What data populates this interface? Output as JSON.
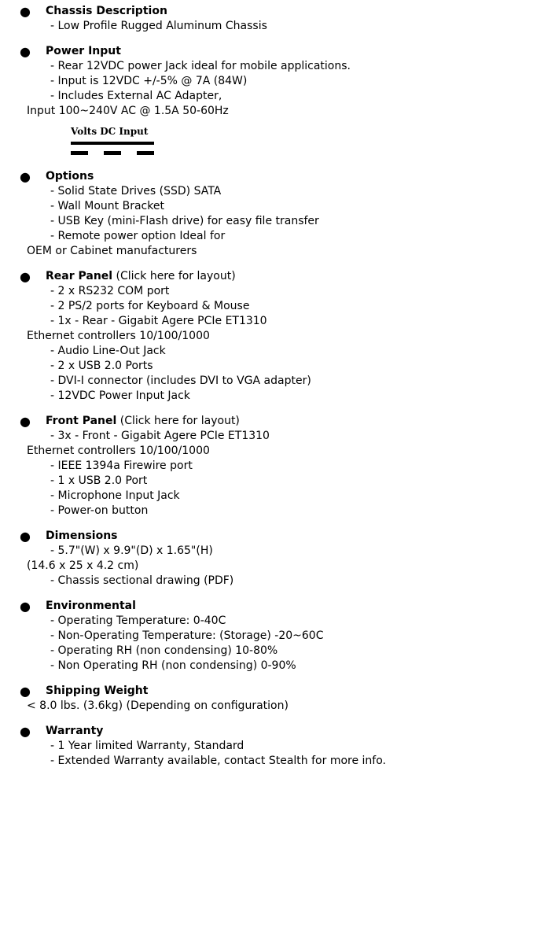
{
  "dc_symbol": {
    "label": "Volts DC Input"
  },
  "items": [
    {
      "title": "Chassis Description",
      "suffix": "",
      "lines": [
        {
          "text": "- Low Profile Rugged Aluminum Chassis",
          "flush": false
        }
      ]
    },
    {
      "title": "Power Input",
      "suffix": "",
      "lines": [
        {
          "text": "- Rear 12VDC power Jack ideal for mobile applications.",
          "flush": false
        },
        {
          "text": "- Input is 12VDC +/-5% @ 7A (84W)",
          "flush": false
        },
        {
          "text": "- Includes External AC Adapter,",
          "flush": false
        },
        {
          "text": "Input 100~240V AC @ 1.5A 50-60Hz",
          "flush": true
        }
      ],
      "has_dc_symbol": true
    },
    {
      "title": "Options",
      "suffix": "",
      "lines": [
        {
          "text": "- Solid State Drives (SSD) SATA",
          "flush": false
        },
        {
          "text": "- Wall Mount Bracket",
          "flush": false
        },
        {
          "text": "- USB Key (mini-Flash drive) for easy file transfer",
          "flush": false
        },
        {
          "text": "- Remote power option Ideal for",
          "flush": false
        },
        {
          "text": "OEM or Cabinet manufacturers",
          "flush": true
        }
      ]
    },
    {
      "title": "Rear Panel",
      "suffix": " (Click here for layout)",
      "lines": [
        {
          "text": "- 2 x RS232 COM port",
          "flush": false
        },
        {
          "text": "- 2 PS/2 ports for Keyboard & Mouse",
          "flush": false
        },
        {
          "text": "- 1x - Rear - Gigabit Agere PCIe ET1310",
          "flush": false
        },
        {
          "text": "Ethernet controllers 10/100/1000",
          "flush": true
        },
        {
          "text": "- Audio Line-Out Jack",
          "flush": false
        },
        {
          "text": "- 2 x USB 2.0 Ports",
          "flush": false
        },
        {
          "text": "- DVI-I connector (includes DVI to VGA adapter)",
          "flush": false
        },
        {
          "text": "- 12VDC Power Input Jack",
          "flush": false
        }
      ]
    },
    {
      "title": "Front Panel",
      "suffix": " (Click here for layout)",
      "lines": [
        {
          "text": "- 3x - Front - Gigabit Agere PCIe ET1310",
          "flush": false
        },
        {
          "text": "Ethernet controllers 10/100/1000",
          "flush": true
        },
        {
          "text": "- IEEE 1394a Firewire port",
          "flush": false
        },
        {
          "text": "- 1 x USB 2.0 Port",
          "flush": false
        },
        {
          "text": "- Microphone Input Jack",
          "flush": false
        },
        {
          "text": "- Power-on button",
          "flush": false
        }
      ]
    },
    {
      "title": "Dimensions",
      "suffix": "",
      "lines": [
        {
          "text": "- 5.7\"(W) x 9.9\"(D) x 1.65\"(H)",
          "flush": false
        },
        {
          "text": "(14.6 x 25 x 4.2 cm)",
          "flush": true
        },
        {
          "text": "- Chassis sectional drawing (PDF)",
          "flush": false
        }
      ]
    },
    {
      "title": "Environmental",
      "suffix": "",
      "lines": [
        {
          "text": "- Operating Temperature: 0-40C",
          "flush": false
        },
        {
          "text": "- Non-Operating Temperature: (Storage) -20~60C",
          "flush": false
        },
        {
          "text": "- Operating RH (non condensing) 10-80%",
          "flush": false
        },
        {
          "text": "- Non Operating RH (non condensing) 0-90%",
          "flush": false
        }
      ]
    },
    {
      "title": "Shipping Weight",
      "suffix": "",
      "lines": [
        {
          "text": "< 8.0 lbs. (3.6kg) (Depending on configuration)",
          "flush": true
        }
      ]
    },
    {
      "title": "Warranty",
      "suffix": "",
      "lines": [
        {
          "text": "- 1 Year limited Warranty, Standard",
          "flush": false
        },
        {
          "text": "- Extended Warranty available, contact Stealth for more info.",
          "flush": false
        }
      ]
    }
  ]
}
